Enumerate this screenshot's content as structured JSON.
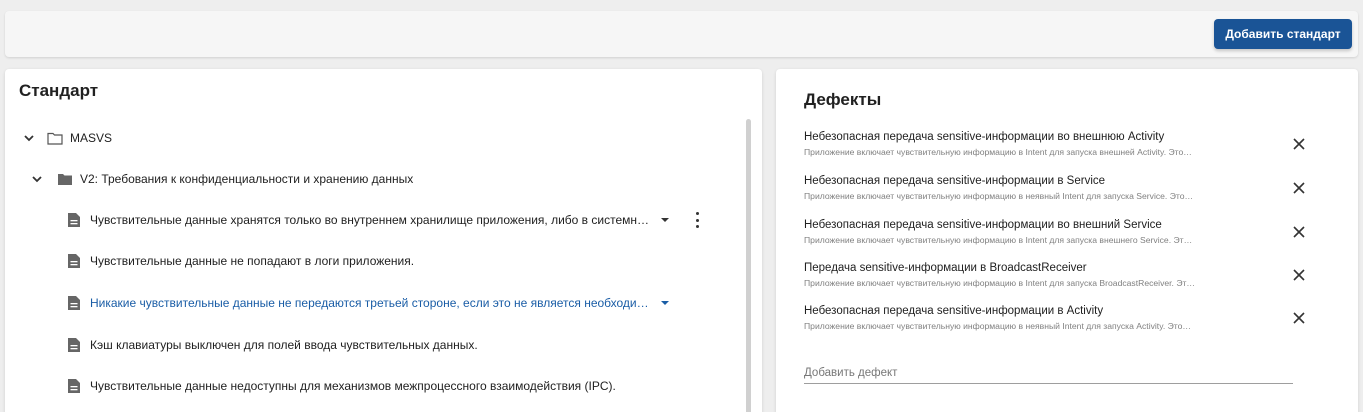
{
  "toolbar": {
    "add_standard_label": "Добавить стандарт"
  },
  "standard_panel": {
    "title": "Стандарт",
    "root": {
      "label": "MASVS"
    },
    "group": {
      "label": "V2: Требования к конфиденциальности и хранению данных"
    },
    "items": [
      {
        "label": "Чувствительные данные хранятся только во внутреннем хранилище приложения, либо в системн…"
      },
      {
        "label": "Чувствительные данные не попадают в логи приложения."
      },
      {
        "label": "Никакие чувствительные данные не передаются третьей стороне, если это не является необходи…"
      },
      {
        "label": "Кэш клавиатуры выключен для полей ввода чувствительных данных."
      },
      {
        "label": "Чувствительные данные недоступны для механизмов межпроцессного взаимодействия (IPC)."
      }
    ]
  },
  "defects_panel": {
    "title": "Дефекты",
    "items": [
      {
        "title": "Небезопасная передача sensitive-информации во внешнюю Activity",
        "desc": "Приложение включает чувствительную информацию в Intent для запуска внешней Activity. Это…"
      },
      {
        "title": "Небезопасная передача sensitive-информации в Service",
        "desc": "Приложение включает чувствительную информацию в неявный Intent для запуска Service. Это…"
      },
      {
        "title": "Небезопасная передача sensitive-информации во внешний Service",
        "desc": "Приложение включает чувствительную информацию в Intent для запуска внешнего Service. Эт…"
      },
      {
        "title": "Передача sensitive-информации в BroadcastReceiver",
        "desc": "Приложение включает чувствительную информацию в Intent для запуска BroadcastReceiver. Эт…"
      },
      {
        "title": "Небезопасная передача sensitive-информации в Activity",
        "desc": "Приложение включает чувствительную информацию в неявный Intent для запуска Activity. Это…"
      }
    ],
    "add_placeholder": "Добавить дефект"
  },
  "colors": {
    "primary": "#1a5496",
    "link": "#1a5da6"
  }
}
